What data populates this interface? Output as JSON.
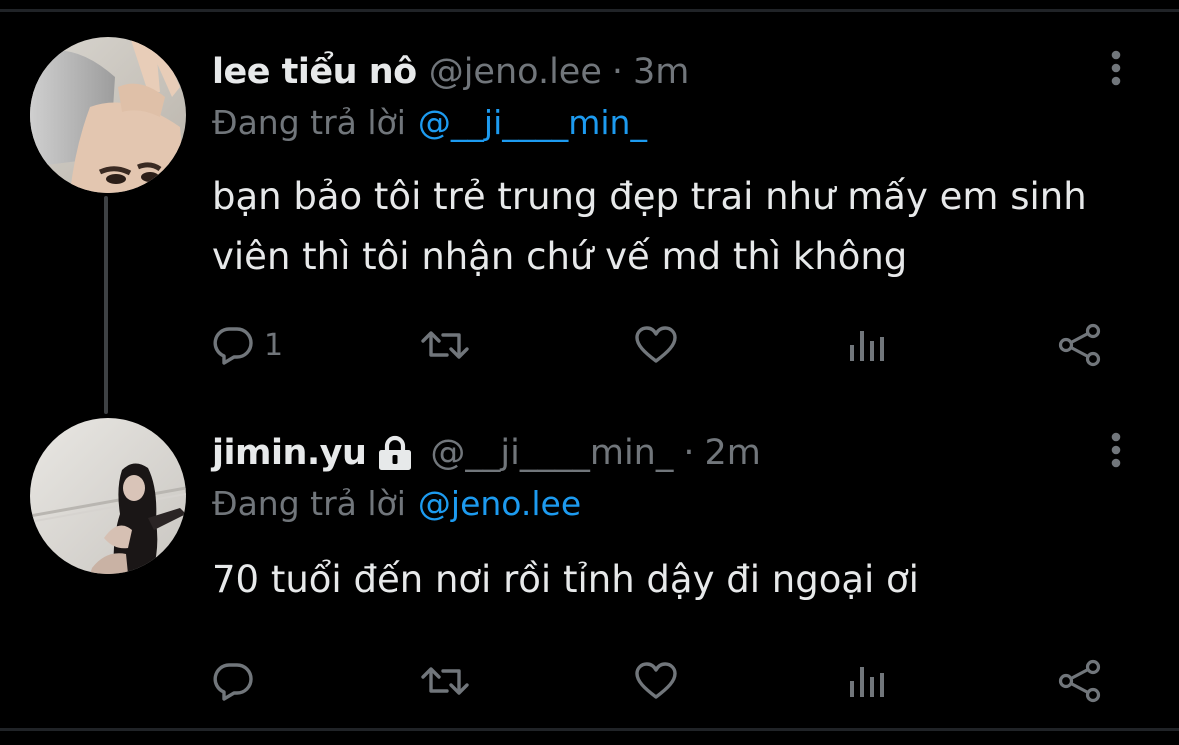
{
  "colors": {
    "background": "#000000",
    "primary_text": "#e7e9ea",
    "secondary_text": "#71767b",
    "link": "#1d9bf0",
    "thread_line": "#3e4144"
  },
  "tweets": [
    {
      "display_name": "lee tiểu nô",
      "handle": "@jeno.lee",
      "separator": "·",
      "time": "3m",
      "protected": false,
      "reply_prefix": "Đang trả lời",
      "reply_to": "@__ji____min_",
      "text": "bạn bảo tôi trẻ trung đẹp trai như mấy em sinh viên thì tôi nhận chứ vế md thì không",
      "actions": {
        "reply_icon": "reply-bubble-icon",
        "reply_count": "1",
        "retweet_icon": "retweet-icon",
        "retweet_count": "",
        "like_icon": "heart-icon",
        "like_count": "",
        "views_icon": "views-chart-icon",
        "share_icon": "share-icon"
      },
      "more_icon": "vertical-dots-icon"
    },
    {
      "display_name": "jimin.yu",
      "handle": "@__ji____min_",
      "separator": "·",
      "time": "2m",
      "protected": true,
      "protected_icon": "lock-icon",
      "reply_prefix": "Đang trả lời",
      "reply_to": "@jeno.lee",
      "text": "70 tuổi đến nơi rồi tỉnh dậy đi ngoại ơi",
      "actions": {
        "reply_icon": "reply-bubble-icon",
        "reply_count": "",
        "retweet_icon": "retweet-icon",
        "retweet_count": "",
        "like_icon": "heart-icon",
        "like_count": "",
        "views_icon": "views-chart-icon",
        "share_icon": "share-icon"
      },
      "more_icon": "vertical-dots-icon"
    }
  ]
}
